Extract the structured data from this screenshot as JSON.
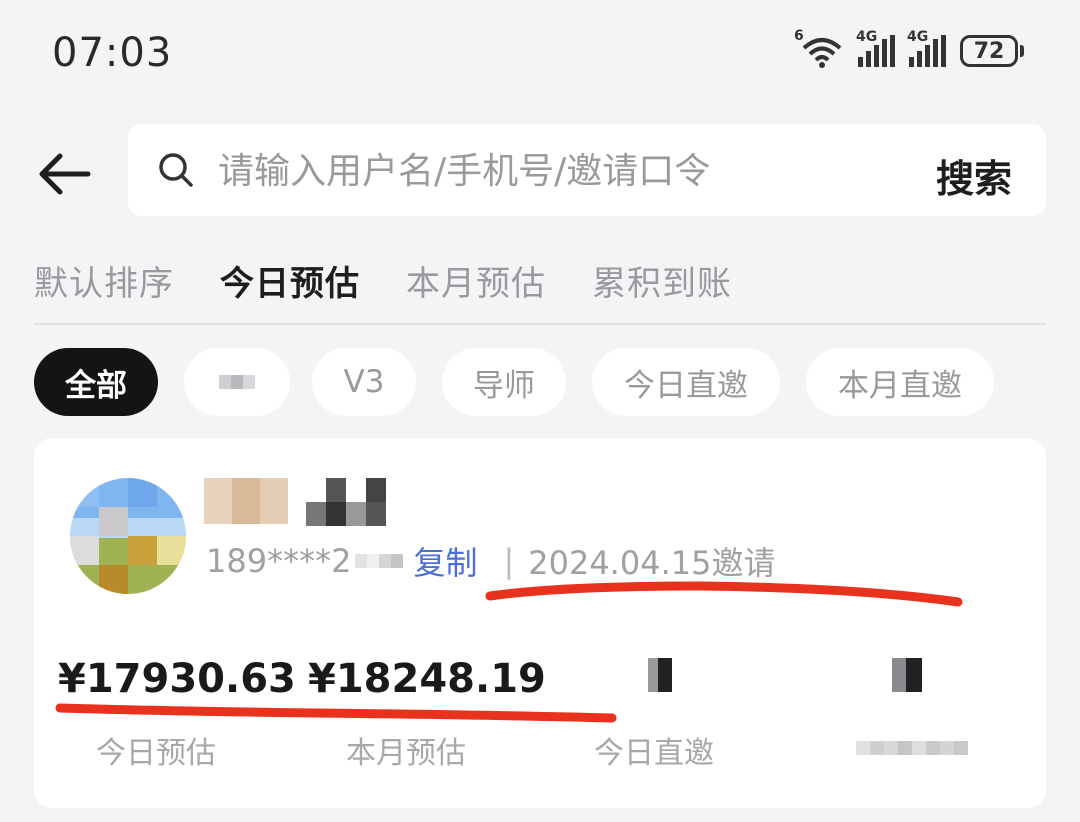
{
  "status_bar": {
    "time": "07:03",
    "wifi_tag": "6",
    "sim1_tag": "4G",
    "sim2_tag": "4G",
    "battery": "72"
  },
  "search": {
    "placeholder": "请输入用户名/手机号/邀请口令",
    "button_label": "搜索"
  },
  "sort_tabs": [
    {
      "label": "默认排序",
      "active": false
    },
    {
      "label": "今日预估",
      "active": true
    },
    {
      "label": "本月预估",
      "active": false
    },
    {
      "label": "累积到账",
      "active": false
    }
  ],
  "filter_chips": [
    {
      "label": "全部",
      "active": true
    },
    {
      "label": "",
      "active": false
    },
    {
      "label": "V3",
      "active": false
    },
    {
      "label": "导师",
      "active": false
    },
    {
      "label": "今日直邀",
      "active": false
    },
    {
      "label": "本月直邀",
      "active": false
    }
  ],
  "member": {
    "phone_masked": "189****2",
    "copy_label": "复制",
    "invite_date": "2024.04.15邀请"
  },
  "stats": [
    {
      "value": "¥17930.63",
      "label": "今日预估"
    },
    {
      "value": "¥18248.19",
      "label": "本月预估"
    },
    {
      "value": "",
      "label": "今日直邀"
    },
    {
      "value": "",
      "label": ""
    }
  ],
  "colors": {
    "accent_red": "#e8321e",
    "link_blue": "#4a6fd8",
    "active_chip": "#141414",
    "background": "#f4f4f6"
  }
}
